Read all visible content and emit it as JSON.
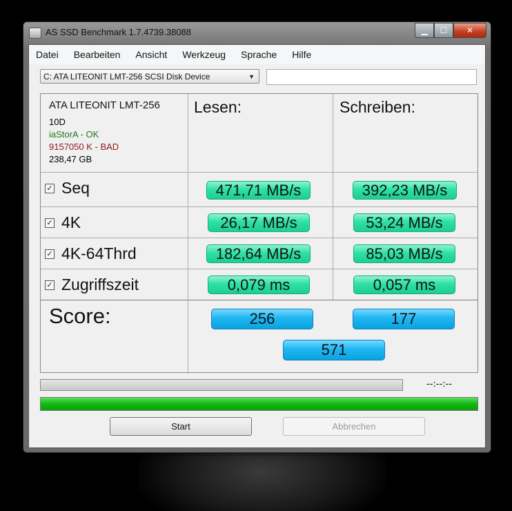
{
  "window": {
    "title": "AS SSD Benchmark 1.7.4739.38088"
  },
  "menu": [
    "Datei",
    "Bearbeiten",
    "Ansicht",
    "Werkzeug",
    "Sprache",
    "Hilfe"
  ],
  "drive_selector": {
    "value": "C: ATA LITEONIT LMT-256 SCSI Disk Device"
  },
  "drive_info": {
    "name": "ATA LITEONIT LMT-256",
    "firmware": "10D",
    "driver": "iaStorA - OK",
    "alignment": "9157050 K - BAD",
    "size": "238,47 GB",
    "driver_color": "#1a7a1a",
    "alignment_color": "#8b1a1a"
  },
  "headers": {
    "read": "Lesen:",
    "write": "Schreiben:"
  },
  "tests": [
    {
      "label": "Seq",
      "checked": true,
      "read": "471,71 MB/s",
      "write": "392,23 MB/s"
    },
    {
      "label": "4K",
      "checked": true,
      "read": "26,17 MB/s",
      "write": "53,24 MB/s"
    },
    {
      "label": "4K-64Thrd",
      "checked": true,
      "read": "182,64 MB/s",
      "write": "85,03 MB/s"
    },
    {
      "label": "Zugriffszeit",
      "checked": true,
      "read": "0,079 ms",
      "write": "0,057 ms"
    }
  ],
  "score": {
    "label": "Score:",
    "read": "256",
    "write": "177",
    "total": "571"
  },
  "status": {
    "time": "--:--:--",
    "progress_fraction": 1.0
  },
  "buttons": {
    "start": "Start",
    "cancel": "Abbrechen"
  },
  "colors": {
    "result_green": "#2fe0a6",
    "score_blue": "#1fb6f2",
    "progress_green": "#12b812"
  }
}
